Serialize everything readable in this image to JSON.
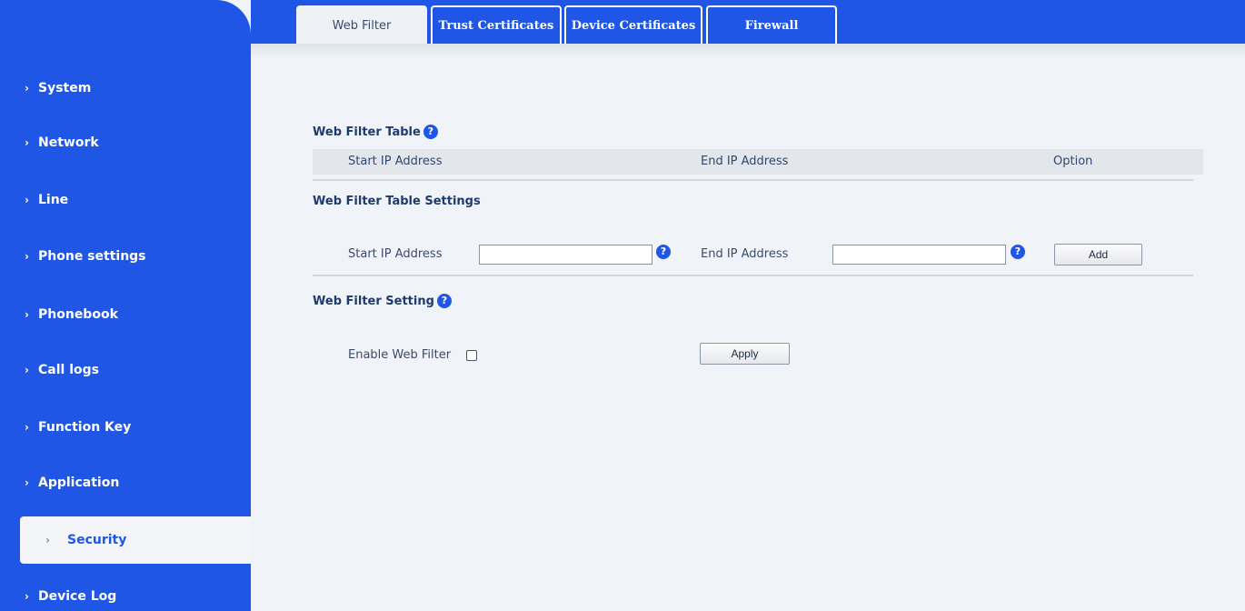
{
  "tabs": [
    {
      "label": "Web Filter",
      "active": true
    },
    {
      "label": "Trust Certificates",
      "active": false
    },
    {
      "label": "Device Certificates",
      "active": false
    },
    {
      "label": "Firewall",
      "active": false
    }
  ],
  "sidebar": {
    "items": [
      {
        "label": "System"
      },
      {
        "label": "Network"
      },
      {
        "label": "Line"
      },
      {
        "label": "Phone settings"
      },
      {
        "label": "Phonebook"
      },
      {
        "label": "Call logs"
      },
      {
        "label": "Function Key"
      },
      {
        "label": "Application"
      },
      {
        "label": "Security",
        "active": true
      },
      {
        "label": "Device Log"
      }
    ],
    "chevron": "›"
  },
  "web_filter_table": {
    "title": "Web Filter Table",
    "columns": [
      "Start IP Address",
      "End IP Address",
      "Option"
    ]
  },
  "table_settings": {
    "title": "Web Filter Table Settings",
    "start_label": "Start IP Address",
    "start_value": "",
    "end_label": "End IP Address",
    "end_value": "",
    "add_label": "Add"
  },
  "filter_setting": {
    "title": "Web Filter Setting",
    "enable_label": "Enable Web Filter",
    "enabled": false,
    "apply_label": "Apply"
  },
  "icons": {
    "help": "?"
  },
  "colors": {
    "brand_blue": "#1f56e6",
    "background": "#f0f4f8",
    "heading": "#1e3a6e"
  }
}
